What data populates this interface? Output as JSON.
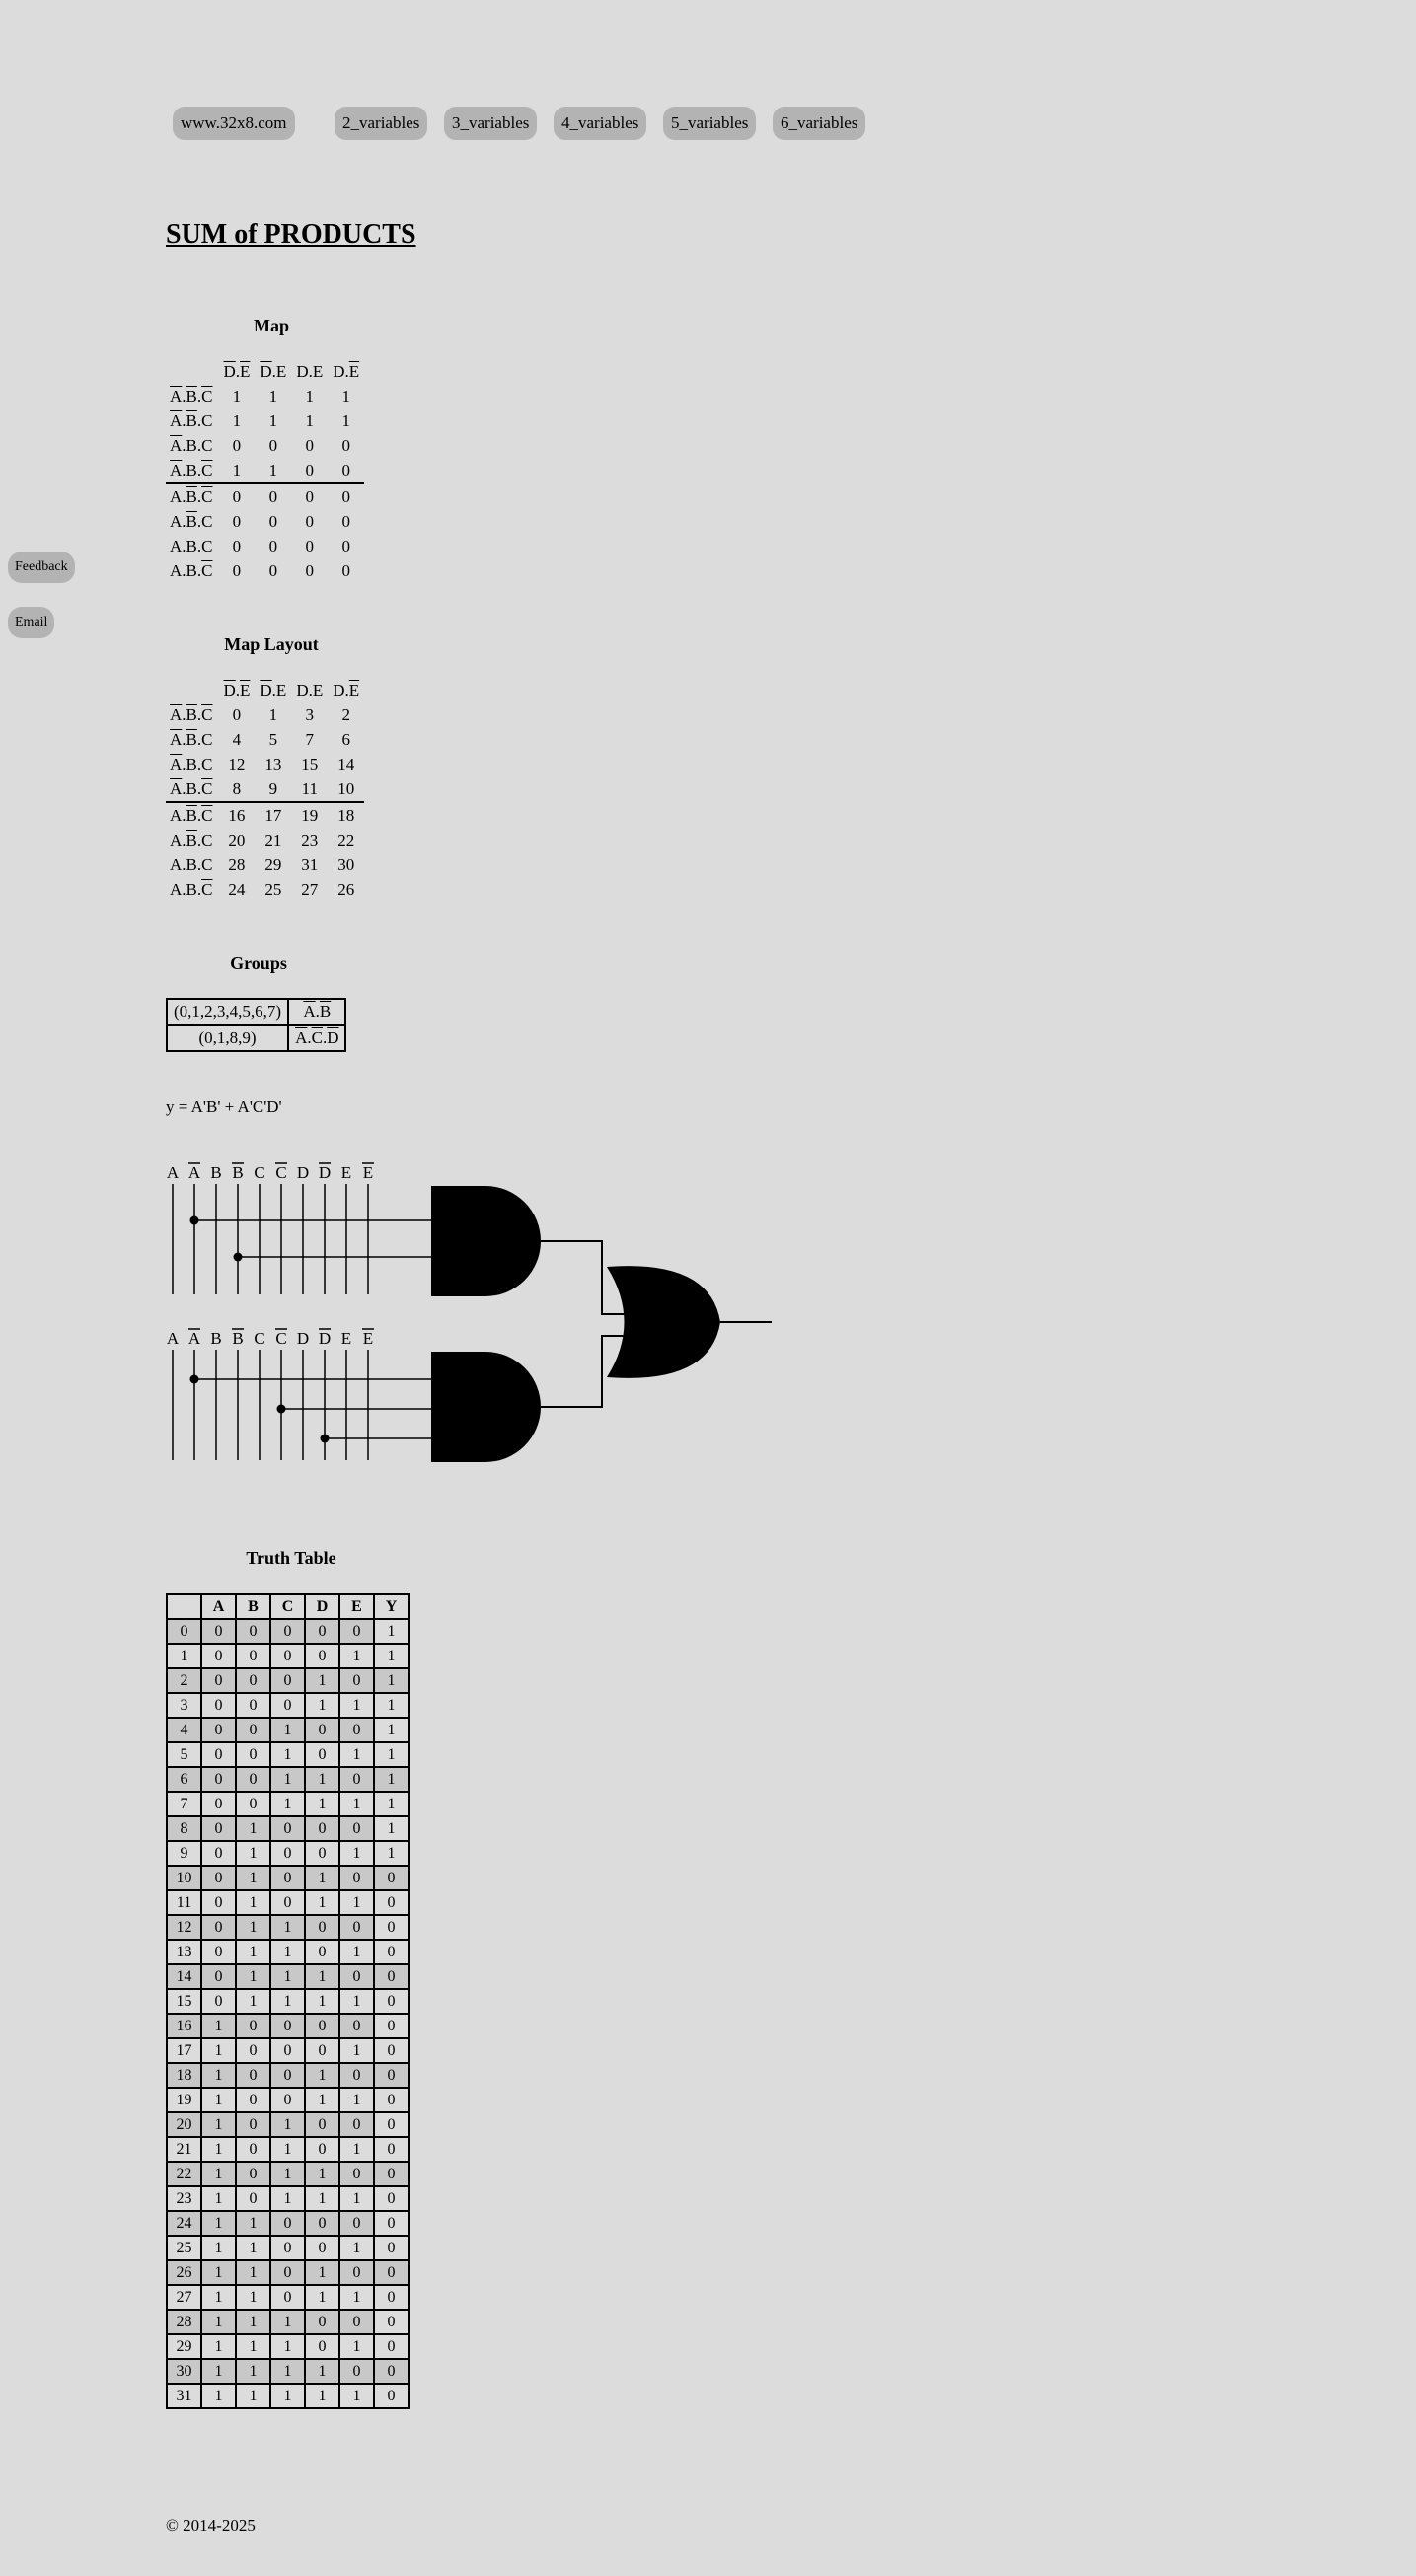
{
  "nav": {
    "home": "www.32x8.com",
    "links": [
      "2_variables",
      "3_variables",
      "4_variables",
      "5_variables",
      "6_variables"
    ]
  },
  "side": {
    "feedback": "Feedback",
    "email": "Email"
  },
  "page_title": "SUM of PRODUCTS",
  "map": {
    "title": "Map",
    "col_headers": [
      [
        {
          "t": "D",
          "o": true
        },
        {
          "t": ".",
          "o": false
        },
        {
          "t": "E",
          "o": true
        }
      ],
      [
        {
          "t": "D",
          "o": true
        },
        {
          "t": ".E",
          "o": false
        }
      ],
      [
        {
          "t": "D.E",
          "o": false
        }
      ],
      [
        {
          "t": "D.",
          "o": false
        },
        {
          "t": "E",
          "o": true
        }
      ]
    ],
    "row_headers": [
      [
        {
          "t": "A",
          "o": true
        },
        {
          "t": ".",
          "o": false
        },
        {
          "t": "B",
          "o": true
        },
        {
          "t": ".",
          "o": false
        },
        {
          "t": "C",
          "o": true
        }
      ],
      [
        {
          "t": "A",
          "o": true
        },
        {
          "t": ".",
          "o": false
        },
        {
          "t": "B",
          "o": true
        },
        {
          "t": ".C",
          "o": false
        }
      ],
      [
        {
          "t": "A",
          "o": true
        },
        {
          "t": ".B.C",
          "o": false
        }
      ],
      [
        {
          "t": "A",
          "o": true
        },
        {
          "t": ".B.",
          "o": false
        },
        {
          "t": "C",
          "o": true
        }
      ],
      [
        {
          "t": "A.",
          "o": false
        },
        {
          "t": "B",
          "o": true
        },
        {
          "t": ".",
          "o": false
        },
        {
          "t": "C",
          "o": true
        }
      ],
      [
        {
          "t": "A.",
          "o": false
        },
        {
          "t": "B",
          "o": true
        },
        {
          "t": ".C",
          "o": false
        }
      ],
      [
        {
          "t": "A.B.C",
          "o": false
        }
      ],
      [
        {
          "t": "A.B.",
          "o": false
        },
        {
          "t": "C",
          "o": true
        }
      ]
    ],
    "values": [
      [
        "1",
        "1",
        "1",
        "1"
      ],
      [
        "1",
        "1",
        "1",
        "1"
      ],
      [
        "0",
        "0",
        "0",
        "0"
      ],
      [
        "1",
        "1",
        "0",
        "0"
      ],
      [
        "0",
        "0",
        "0",
        "0"
      ],
      [
        "0",
        "0",
        "0",
        "0"
      ],
      [
        "0",
        "0",
        "0",
        "0"
      ],
      [
        "0",
        "0",
        "0",
        "0"
      ]
    ]
  },
  "layout": {
    "title": "Map Layout",
    "values": [
      [
        "0",
        "1",
        "3",
        "2"
      ],
      [
        "4",
        "5",
        "7",
        "6"
      ],
      [
        "12",
        "13",
        "15",
        "14"
      ],
      [
        "8",
        "9",
        "11",
        "10"
      ],
      [
        "16",
        "17",
        "19",
        "18"
      ],
      [
        "20",
        "21",
        "23",
        "22"
      ],
      [
        "28",
        "29",
        "31",
        "30"
      ],
      [
        "24",
        "25",
        "27",
        "26"
      ]
    ]
  },
  "groups": {
    "title": "Groups",
    "rows": [
      {
        "minterms": "(0,1,2,3,4,5,6,7)",
        "term": [
          {
            "t": "A",
            "o": true
          },
          {
            "t": ".",
            "o": false
          },
          {
            "t": "B",
            "o": true
          }
        ]
      },
      {
        "minterms": "(0,1,8,9)",
        "term": [
          {
            "t": "A",
            "o": true
          },
          {
            "t": ".",
            "o": false
          },
          {
            "t": "C",
            "o": true
          },
          {
            "t": ".",
            "o": false
          },
          {
            "t": "D",
            "o": true
          }
        ]
      }
    ]
  },
  "expression": "y = A'B' + A'C'D'",
  "circuit": {
    "input_labels": [
      {
        "t": "A",
        "o": false
      },
      {
        "t": "A",
        "o": true
      },
      {
        "t": "B",
        "o": false
      },
      {
        "t": "B",
        "o": true
      },
      {
        "t": "C",
        "o": false
      },
      {
        "t": "C",
        "o": true
      },
      {
        "t": "D",
        "o": false
      },
      {
        "t": "D",
        "o": true
      },
      {
        "t": "E",
        "o": false
      },
      {
        "t": "E",
        "o": true
      }
    ],
    "gate1_taps": [
      1,
      3
    ],
    "gate2_taps": [
      1,
      5,
      7
    ]
  },
  "truth_table": {
    "title": "Truth Table",
    "headers": [
      "",
      "A",
      "B",
      "C",
      "D",
      "E",
      "Y"
    ],
    "rows": [
      [
        "0",
        "0",
        "0",
        "0",
        "0",
        "0",
        "1"
      ],
      [
        "1",
        "0",
        "0",
        "0",
        "0",
        "1",
        "1"
      ],
      [
        "2",
        "0",
        "0",
        "0",
        "1",
        "0",
        "1"
      ],
      [
        "3",
        "0",
        "0",
        "0",
        "1",
        "1",
        "1"
      ],
      [
        "4",
        "0",
        "0",
        "1",
        "0",
        "0",
        "1"
      ],
      [
        "5",
        "0",
        "0",
        "1",
        "0",
        "1",
        "1"
      ],
      [
        "6",
        "0",
        "0",
        "1",
        "1",
        "0",
        "1"
      ],
      [
        "7",
        "0",
        "0",
        "1",
        "1",
        "1",
        "1"
      ],
      [
        "8",
        "0",
        "1",
        "0",
        "0",
        "0",
        "1"
      ],
      [
        "9",
        "0",
        "1",
        "0",
        "0",
        "1",
        "1"
      ],
      [
        "10",
        "0",
        "1",
        "0",
        "1",
        "0",
        "0"
      ],
      [
        "11",
        "0",
        "1",
        "0",
        "1",
        "1",
        "0"
      ],
      [
        "12",
        "0",
        "1",
        "1",
        "0",
        "0",
        "0"
      ],
      [
        "13",
        "0",
        "1",
        "1",
        "0",
        "1",
        "0"
      ],
      [
        "14",
        "0",
        "1",
        "1",
        "1",
        "0",
        "0"
      ],
      [
        "15",
        "0",
        "1",
        "1",
        "1",
        "1",
        "0"
      ],
      [
        "16",
        "1",
        "0",
        "0",
        "0",
        "0",
        "0"
      ],
      [
        "17",
        "1",
        "0",
        "0",
        "0",
        "1",
        "0"
      ],
      [
        "18",
        "1",
        "0",
        "0",
        "1",
        "0",
        "0"
      ],
      [
        "19",
        "1",
        "0",
        "0",
        "1",
        "1",
        "0"
      ],
      [
        "20",
        "1",
        "0",
        "1",
        "0",
        "0",
        "0"
      ],
      [
        "21",
        "1",
        "0",
        "1",
        "0",
        "1",
        "0"
      ],
      [
        "22",
        "1",
        "0",
        "1",
        "1",
        "0",
        "0"
      ],
      [
        "23",
        "1",
        "0",
        "1",
        "1",
        "1",
        "0"
      ],
      [
        "24",
        "1",
        "1",
        "0",
        "0",
        "0",
        "0"
      ],
      [
        "25",
        "1",
        "1",
        "0",
        "0",
        "1",
        "0"
      ],
      [
        "26",
        "1",
        "1",
        "0",
        "1",
        "0",
        "0"
      ],
      [
        "27",
        "1",
        "1",
        "0",
        "1",
        "1",
        "0"
      ],
      [
        "28",
        "1",
        "1",
        "1",
        "0",
        "0",
        "0"
      ],
      [
        "29",
        "1",
        "1",
        "1",
        "0",
        "1",
        "0"
      ],
      [
        "30",
        "1",
        "1",
        "1",
        "1",
        "0",
        "0"
      ],
      [
        "31",
        "1",
        "1",
        "1",
        "1",
        "1",
        "0"
      ]
    ]
  },
  "footer": "© 2014-2025"
}
